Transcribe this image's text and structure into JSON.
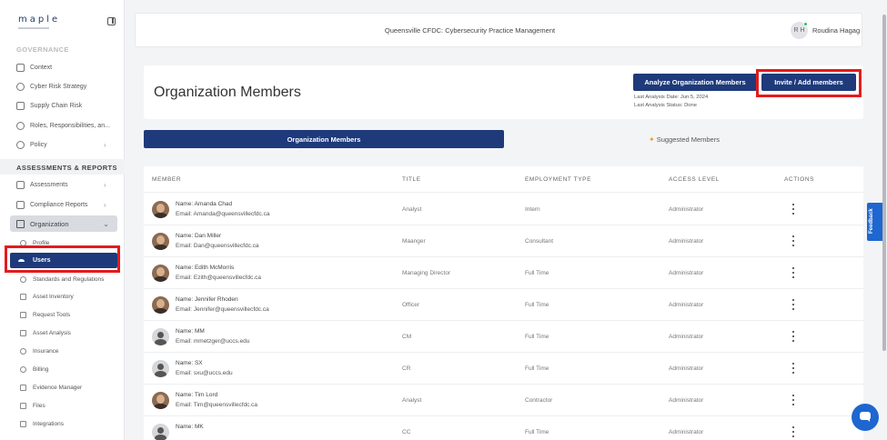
{
  "sidebar": {
    "logo": "maple",
    "sections": {
      "governance": "GOVERNANCE",
      "assessments_reports": "ASSESSMENTS & REPORTS"
    },
    "governance_items": [
      {
        "label": "Context",
        "icon": "document-icon"
      },
      {
        "label": "Cyber Risk Strategy",
        "icon": "strategy-icon"
      },
      {
        "label": "Supply Chain Risk",
        "icon": "supply-chain-icon"
      },
      {
        "label": "Roles, Responsibilities, an...",
        "icon": "roles-icon"
      },
      {
        "label": "Policy",
        "icon": "policy-icon"
      }
    ],
    "report_items": [
      {
        "label": "Assessments",
        "icon": "assessment-icon"
      },
      {
        "label": "Compliance Reports",
        "icon": "compliance-icon"
      }
    ],
    "organization_label": "Organization",
    "organization_sub": [
      {
        "label": "Profile",
        "icon": "profile-icon"
      },
      {
        "label": "Users",
        "icon": "users-icon"
      },
      {
        "label": "Standards and Regulations",
        "icon": "standards-icon"
      },
      {
        "label": "Asset Inventory",
        "icon": "inventory-icon"
      },
      {
        "label": "Request Tools",
        "icon": "tools-icon"
      },
      {
        "label": "Asset Analysis",
        "icon": "analysis-icon"
      },
      {
        "label": "Insurance",
        "icon": "insurance-icon"
      },
      {
        "label": "Billing",
        "icon": "billing-icon"
      },
      {
        "label": "Evidence Manager",
        "icon": "evidence-icon"
      },
      {
        "label": "Files",
        "icon": "files-icon"
      },
      {
        "label": "Integrations",
        "icon": "integrations-icon"
      }
    ]
  },
  "header": {
    "title": "Queensville CFDC: Cybersecurity Practice Management",
    "avatar_initials": "R H",
    "user_name": "Roudina Hagag"
  },
  "page": {
    "title": "Organization Members",
    "analyze_button": "Analyze Organization Members",
    "last_analysis_date": "Last Analysis Date: Jun 5, 2024",
    "last_analysis_status": "Last Analysis Status: Done",
    "invite_button": "Invite / Add members"
  },
  "tabs": {
    "members": "Organization Members",
    "suggested": "Suggested Members"
  },
  "table": {
    "columns": [
      "MEMBER",
      "TITLE",
      "EMPLOYMENT TYPE",
      "ACCESS LEVEL",
      "ACTIONS"
    ],
    "rows": [
      {
        "name": "Name: Amanda Chad",
        "email": "Email: Amanda@queensvillecfdc.ca",
        "title": "Analyst",
        "employment": "Intern",
        "access": "Administrator",
        "avatar": "photo"
      },
      {
        "name": "Name: Dan Miller",
        "email": "Email: Dan@queensvillecfdc.ca",
        "title": "Maanger",
        "employment": "Consultant",
        "access": "Administrator",
        "avatar": "photo"
      },
      {
        "name": "Name: Edith McMorris",
        "email": "Email: Ezith@queensvillecfdc.ca",
        "title": "Managing Director",
        "employment": "Full Time",
        "access": "Administrator",
        "avatar": "photo"
      },
      {
        "name": "Name: Jennifer Rhoden",
        "email": "Email: Jennifer@queensvillecfdc.ca",
        "title": "Officer",
        "employment": "Full Time",
        "access": "Administrator",
        "avatar": "photo"
      },
      {
        "name": "Name: MM",
        "email": "Email: mmetzger@uccs.edu",
        "title": "CM",
        "employment": "Full Time",
        "access": "Administrator",
        "avatar": "generic"
      },
      {
        "name": "Name: SX",
        "email": "Email: sxu@uccs.edu",
        "title": "CR",
        "employment": "Full Time",
        "access": "Administrator",
        "avatar": "generic"
      },
      {
        "name": "Name: Tim Lord",
        "email": "Email: Tim@queensvillecfdc.ca",
        "title": "Analyst",
        "employment": "Contractor",
        "access": "Administrator",
        "avatar": "photo"
      },
      {
        "name": "Name: MK",
        "email": "",
        "title": "CC",
        "employment": "Full Time",
        "access": "Administrator",
        "avatar": "generic"
      }
    ]
  },
  "feedback_label": "Feedback",
  "colors": {
    "primary": "#1e3a7b",
    "highlight": "#e31b1b",
    "feedback": "#1e66d0"
  }
}
